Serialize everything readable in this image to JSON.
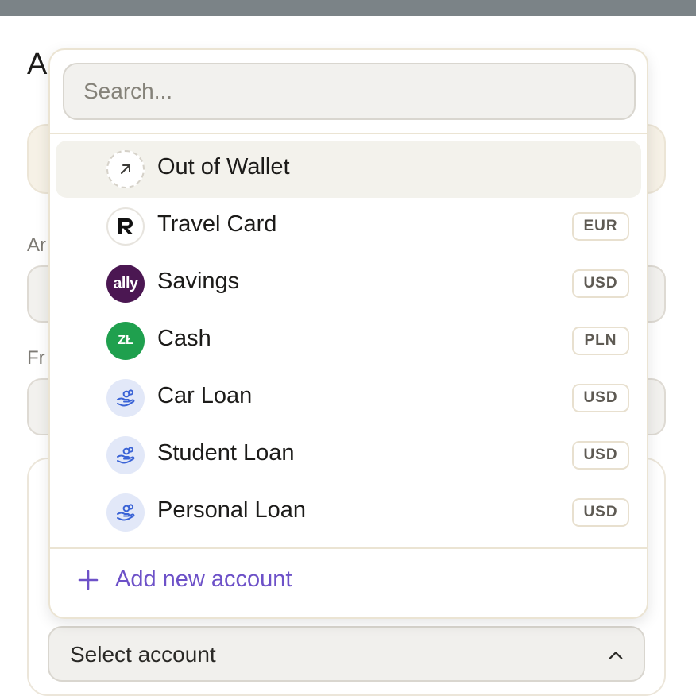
{
  "background": {
    "title_fragment": "A",
    "label_amount_fragment": "Ar",
    "label_from_fragment": "Fr"
  },
  "search": {
    "placeholder": "Search...",
    "value": ""
  },
  "accounts": [
    {
      "label": "Out of Wallet",
      "icon": "arrow-up-right-icon",
      "currency": "",
      "selected": true
    },
    {
      "label": "Travel Card",
      "icon": "revolut-logo",
      "logo_text": "R",
      "currency": "EUR"
    },
    {
      "label": "Savings",
      "icon": "ally-logo",
      "logo_text": "ally",
      "currency": "USD"
    },
    {
      "label": "Cash",
      "icon": "zloty-icon",
      "logo_text": "ZŁ",
      "currency": "PLN"
    },
    {
      "label": "Car Loan",
      "icon": "loan-icon",
      "currency": "USD"
    },
    {
      "label": "Student Loan",
      "icon": "loan-icon",
      "currency": "USD"
    },
    {
      "label": "Personal Loan",
      "icon": "loan-icon",
      "currency": "USD"
    }
  ],
  "add_account": {
    "label": "Add new account"
  },
  "select_account": {
    "label": "Select account"
  },
  "colors": {
    "accent": "#6d51c8",
    "selected_row": "#f3f2ec",
    "ally_brand": "#4b1752",
    "cash_green": "#1fa04e",
    "loan_bg": "#e2e8f8",
    "loan_icon": "#3a63d6"
  }
}
